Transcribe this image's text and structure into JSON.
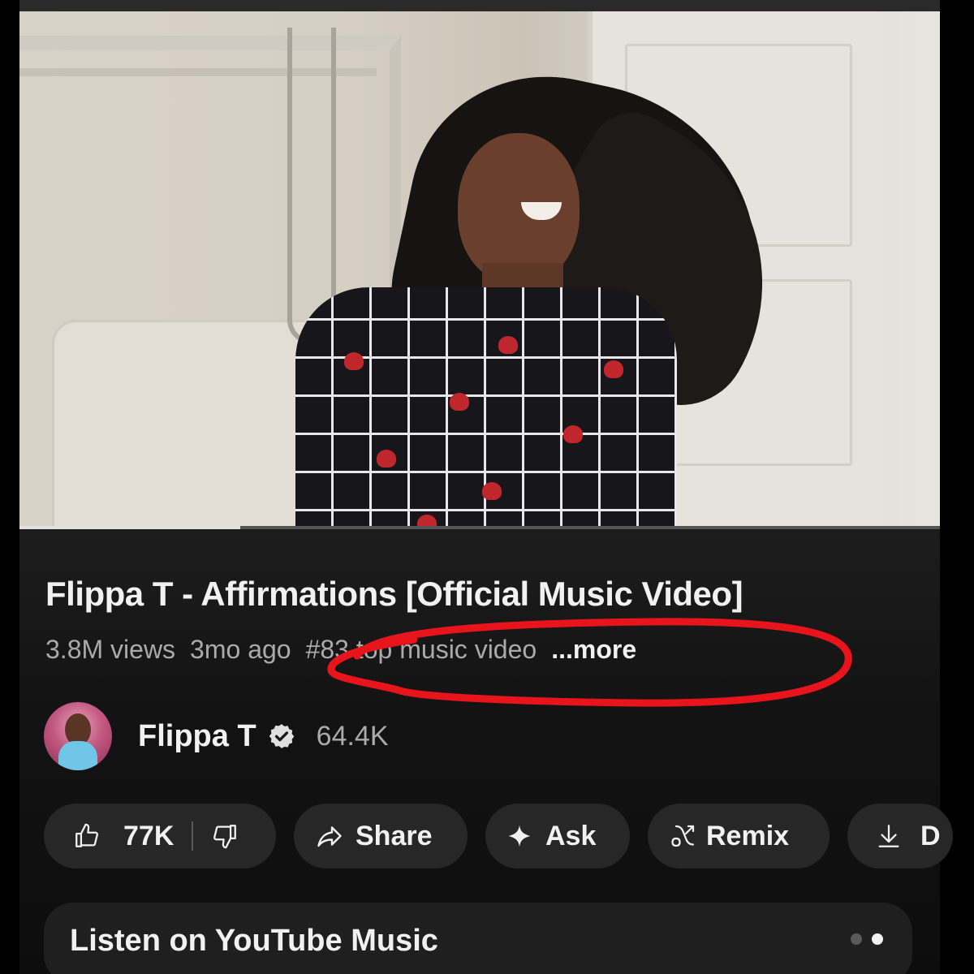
{
  "video": {
    "title": "Flippa T - Affirmations [Official Music Video]",
    "progress_fraction": 0.24
  },
  "meta": {
    "views": "3.8M views",
    "age": "3mo ago",
    "rank": "#83 top music video",
    "more": "...more"
  },
  "channel": {
    "name": "Flippa T",
    "subscribers": "64.4K",
    "verified_icon": "verified-icon"
  },
  "actions": {
    "like_count": "77K",
    "share_label": "Share",
    "ask_label": "Ask",
    "remix_label": "Remix",
    "download_label": "D"
  },
  "youtube_music": {
    "title": "Listen on YouTube Music"
  },
  "annotation": {
    "color": "#e8141b"
  }
}
